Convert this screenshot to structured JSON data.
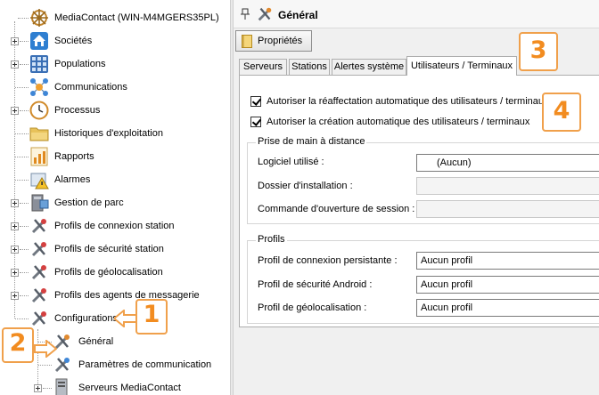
{
  "tree": {
    "items": [
      {
        "label": "MediaContact (WIN-M4MGERS35PL)",
        "icon": "wheel-icon",
        "expandable": false
      },
      {
        "label": "Sociétés",
        "icon": "house-icon",
        "expandable": true
      },
      {
        "label": "Populations",
        "icon": "grid-icon",
        "expandable": true
      },
      {
        "label": "Communications",
        "icon": "network-icon",
        "expandable": false
      },
      {
        "label": "Processus",
        "icon": "clock-icon",
        "expandable": true
      },
      {
        "label": "Historiques d'exploitation",
        "icon": "folder-icon",
        "expandable": false
      },
      {
        "label": "Rapports",
        "icon": "chart-icon",
        "expandable": false
      },
      {
        "label": "Alarmes",
        "icon": "alarm-icon",
        "expandable": false
      },
      {
        "label": "Gestion de parc",
        "icon": "monitor-icon",
        "expandable": true
      },
      {
        "label": "Profils de connexion station",
        "icon": "tools-icon",
        "expandable": true
      },
      {
        "label": "Profils de sécurité station",
        "icon": "tools-icon",
        "expandable": true
      },
      {
        "label": "Profils de géolocalisation",
        "icon": "tools-icon",
        "expandable": true
      },
      {
        "label": "Profils des agents de messagerie",
        "icon": "tools-icon",
        "expandable": true
      },
      {
        "label": "Configurations",
        "icon": "tools-icon",
        "expandable": false
      },
      {
        "label": "Général",
        "icon": "tools-icon",
        "expandable": false
      },
      {
        "label": "Paramètres de communication",
        "icon": "tools-icon",
        "expandable": false
      },
      {
        "label": "Serveurs MediaContact",
        "icon": "server-icon",
        "expandable": true
      }
    ]
  },
  "header": {
    "title": "Général",
    "pin": "pin-icon"
  },
  "toolbar": {
    "properties_label": "Propriétés"
  },
  "tabs": [
    "Serveurs",
    "Stations",
    "Alertes système",
    "Utilisateurs / Terminaux"
  ],
  "active_tab": "Utilisateurs / Terminaux",
  "options": {
    "reassign": {
      "label": "Autoriser la réaffectation automatique des utilisateurs / terminaux",
      "checked": true
    },
    "create": {
      "label": "Autoriser la création automatique des utilisateurs / terminaux",
      "checked": true
    }
  },
  "remote": {
    "title": "Prise de main à distance",
    "software_label": "Logiciel utilisé :",
    "software_value": "(Aucun)",
    "install_label": "Dossier d'installation :",
    "install_value": "",
    "command_label": "Commande d'ouverture de session :",
    "command_value": ""
  },
  "profiles": {
    "title": "Profils",
    "persistent_label": "Profil de connexion persistante :",
    "persistent_value": "Aucun profil",
    "security_label": "Profil de sécurité Android :",
    "security_value": "Aucun profil",
    "geo_label": "Profil de géolocalisation :",
    "geo_value": "Aucun profil"
  },
  "annotations": {
    "n1": "1",
    "n2": "2",
    "n3": "3",
    "n4": "4"
  },
  "colors": {
    "annotation": "#f28c20",
    "annotation_border": "#f0a04b"
  }
}
